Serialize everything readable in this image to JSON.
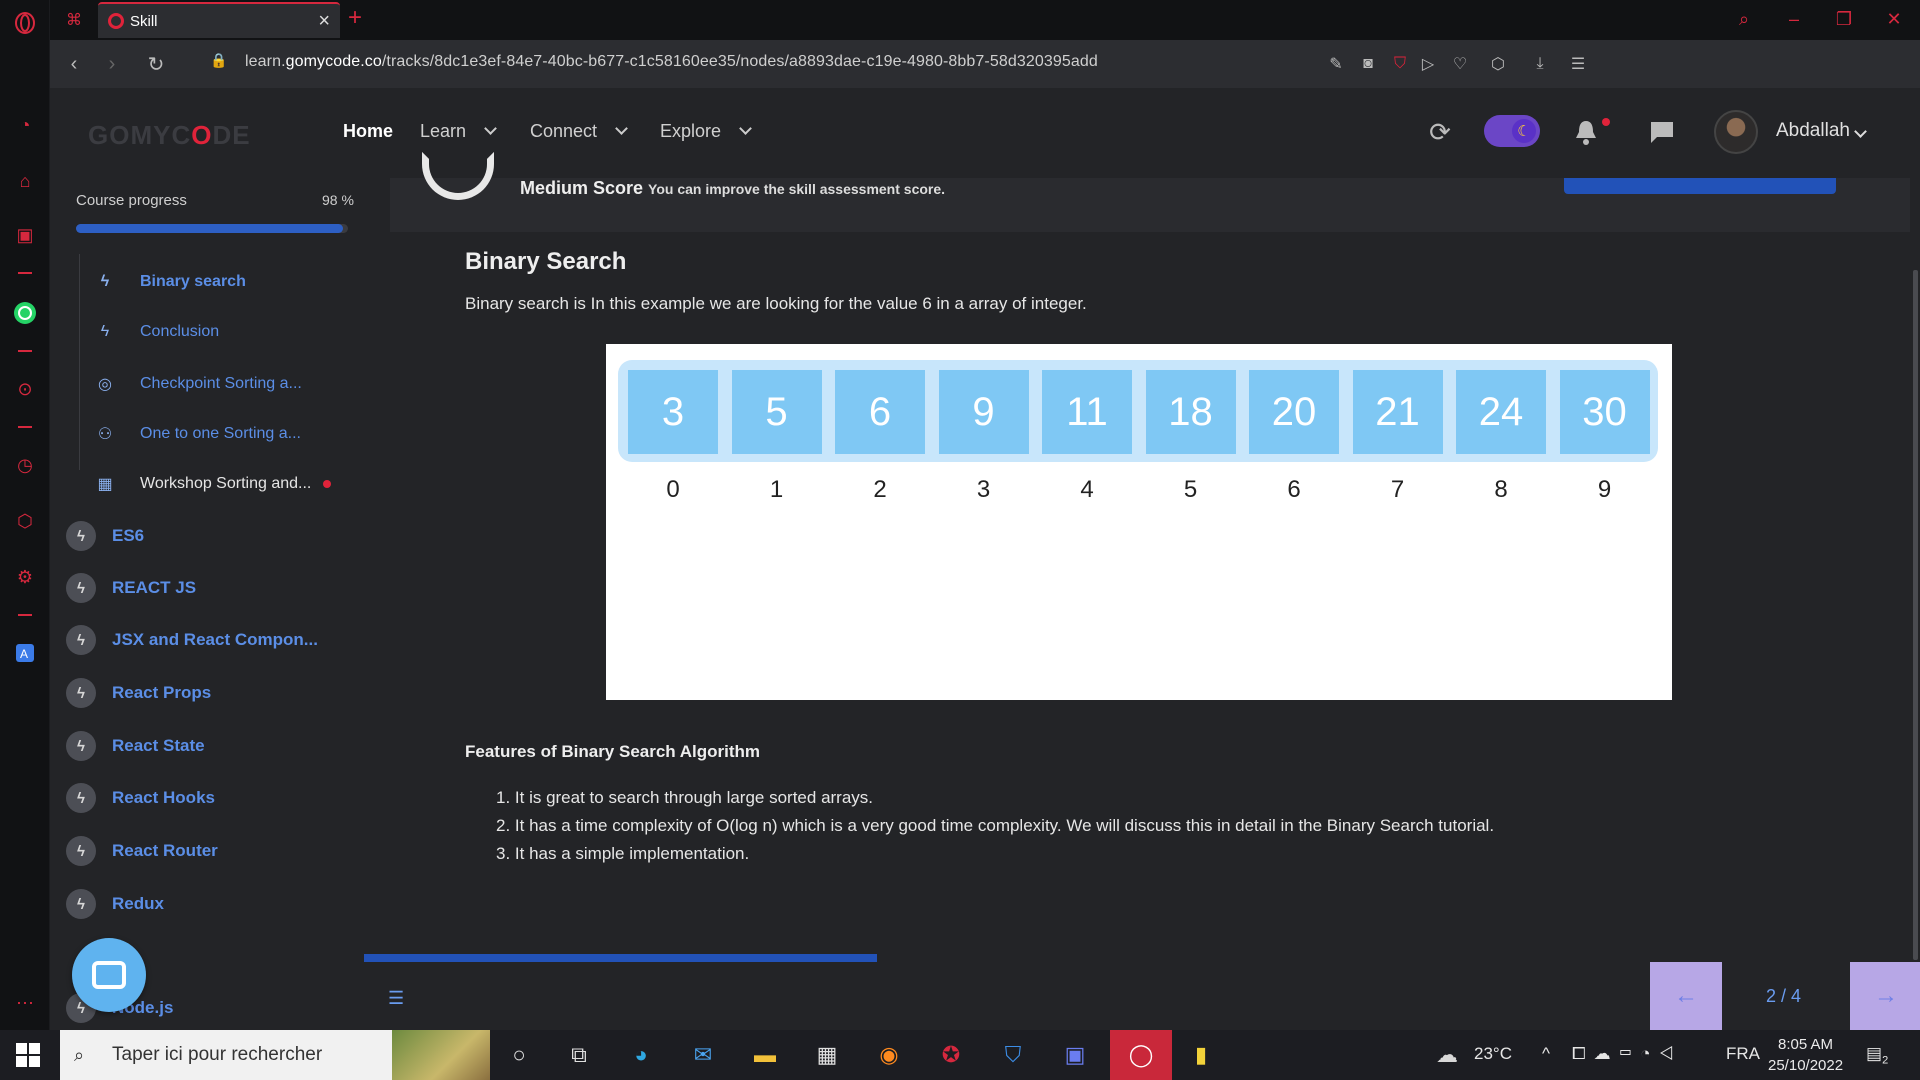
{
  "browser": {
    "tab_title": "Skill",
    "url_prefix": "learn.",
    "url_domain": "gomycode.co",
    "url_path": "/tracks/8dc1e3ef-84e7-40bc-b677-c1c58160ee35/nodes/a8893dae-c19e-4980-8bb7-58d320395add"
  },
  "header": {
    "logo_pre": "GOMYC",
    "logo_o": "O",
    "logo_post": "DE",
    "nav": {
      "home": "Home",
      "learn": "Learn",
      "connect": "Connect",
      "explore": "Explore"
    },
    "username": "Abdallah"
  },
  "sidebar": {
    "progress_label": "Course progress",
    "progress_value": "98 %",
    "progress_fraction": 0.98,
    "sub_items": [
      {
        "label": "Binary search",
        "icon": "bolt-icon"
      },
      {
        "label": "Conclusion",
        "icon": "bolt-icon"
      },
      {
        "label": "Checkpoint Sorting a...",
        "icon": "target-icon"
      },
      {
        "label": "One to one Sorting a...",
        "icon": "people-icon"
      },
      {
        "label": "Workshop Sorting and...",
        "icon": "workshop-icon"
      }
    ],
    "modules": [
      {
        "label": "ES6"
      },
      {
        "label": "REACT JS"
      },
      {
        "label": "JSX and React Compon..."
      },
      {
        "label": "React Props"
      },
      {
        "label": "React State"
      },
      {
        "label": "React Hooks"
      },
      {
        "label": "React Router"
      },
      {
        "label": "Redux"
      },
      {
        "label": "Node.js"
      }
    ]
  },
  "main": {
    "score_title": "Medium Score",
    "score_sub": "You can improve the skill assessment score.",
    "title": "Binary Search",
    "intro": "Binary search is In this example we are looking for the value 6 in a array of integer.",
    "array_values": [
      "3",
      "5",
      "6",
      "9",
      "11",
      "18",
      "20",
      "21",
      "24",
      "30"
    ],
    "array_indices": [
      "0",
      "1",
      "2",
      "3",
      "4",
      "5",
      "6",
      "7",
      "8",
      "9"
    ],
    "features_title": "Features of Binary Search Algorithm",
    "features": [
      "1. It is great to search through large sorted arrays.",
      "2. It has a time complexity of O(log n) which is a very good time complexity. We will discuss this in detail in the Binary Search tutorial.",
      "3. It has a simple implementation."
    ],
    "pager": "2 / 4",
    "pager_prev": "←",
    "pager_next": "→",
    "lesson_progress_fraction": 0.33
  },
  "taskbar": {
    "search_placeholder": "Taper ici pour rechercher",
    "weather": "23°C",
    "language": "FRA",
    "time": "8:05 AM",
    "date": "25/10/2022",
    "notification_count": "2"
  },
  "colors": {
    "accent_red": "#e0233a",
    "link_blue": "#5b8ee6",
    "progress_blue": "#2d5fc4",
    "cell_blue": "#7fc8f4"
  }
}
